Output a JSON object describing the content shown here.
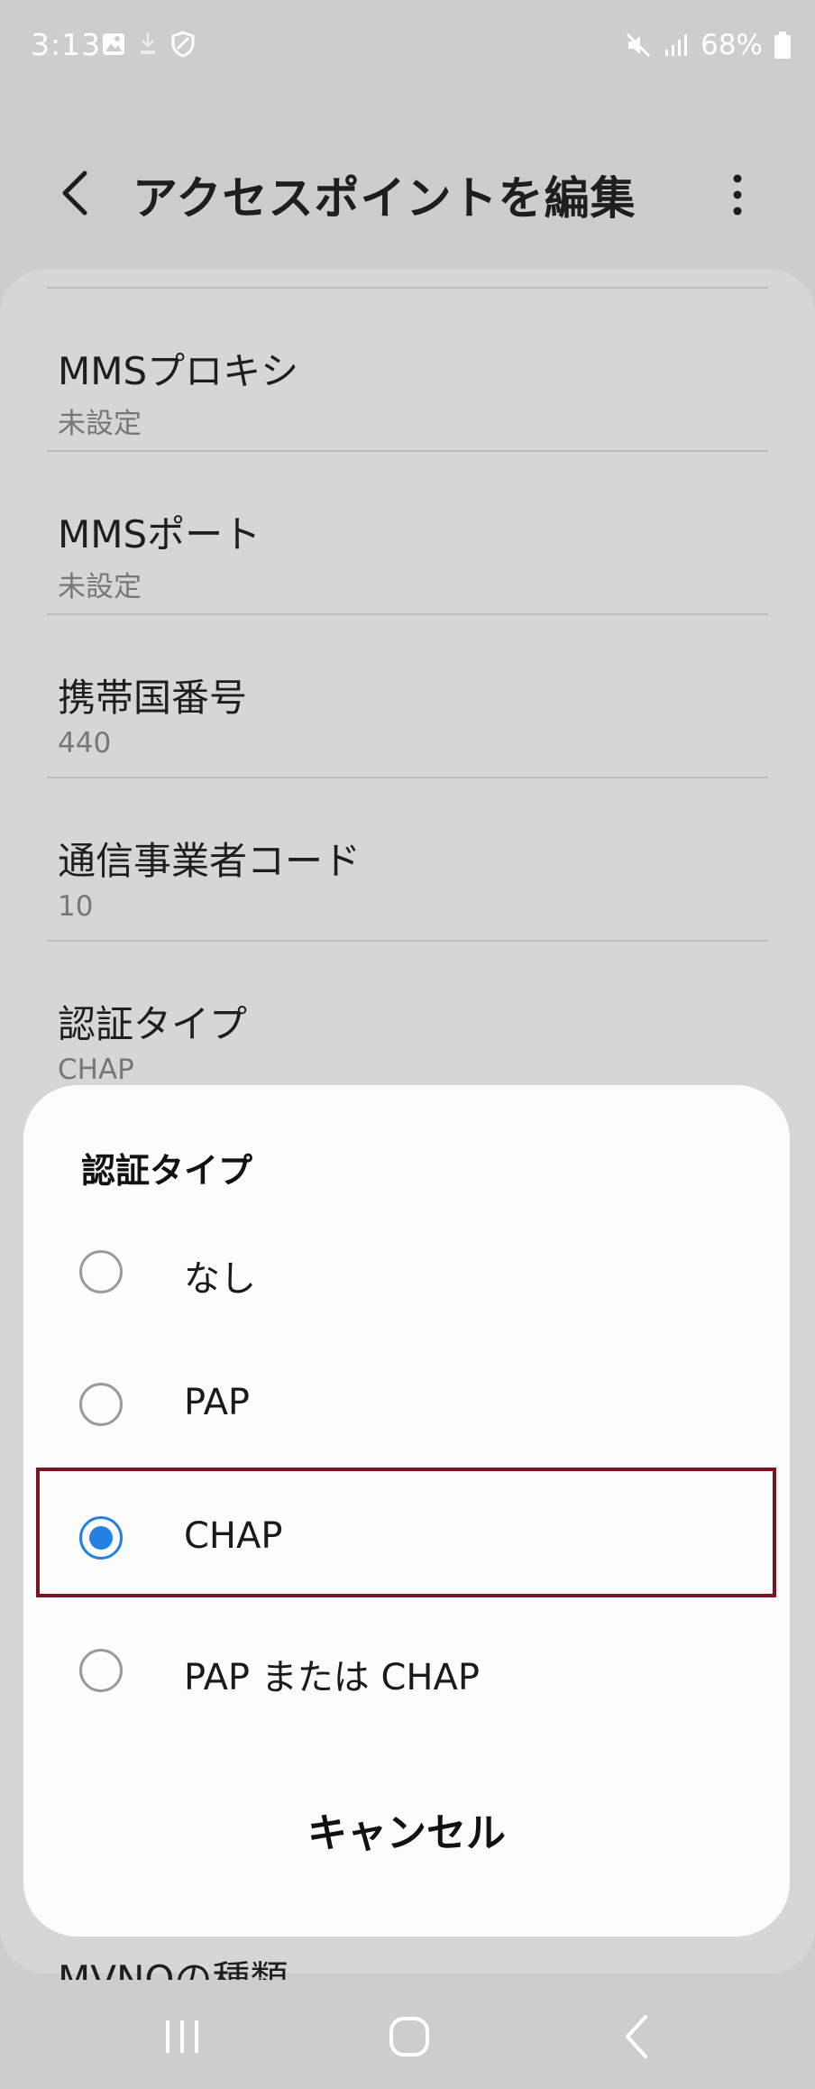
{
  "status_bar": {
    "time": "3:13",
    "battery": "68%",
    "icons_left": [
      "image-icon",
      "download-icon",
      "shield-icon"
    ],
    "icons_right": [
      "mute-icon",
      "signal-icon",
      "battery-icon"
    ]
  },
  "header": {
    "title": "アクセスポイントを編集"
  },
  "settings": {
    "items": [
      {
        "title": "MMSプロキシ",
        "value": "未設定"
      },
      {
        "title": "MMSポート",
        "value": "未設定"
      },
      {
        "title": "携帯国番号",
        "value": "440"
      },
      {
        "title": "通信事業者コード",
        "value": "10"
      },
      {
        "title": "認証タイプ",
        "value": "CHAP"
      }
    ],
    "peek_item": "MVNOの種類"
  },
  "dialog": {
    "title": "認証タイプ",
    "options": [
      {
        "label": "なし",
        "selected": false
      },
      {
        "label": "PAP",
        "selected": false
      },
      {
        "label": "CHAP",
        "selected": true
      },
      {
        "label": "PAP または CHAP",
        "selected": false
      }
    ],
    "cancel_label": "キャンセル"
  },
  "colors": {
    "accent": "#2481e3",
    "highlight_border": "#7b1422",
    "scrim_background": "#cdcdcd"
  }
}
